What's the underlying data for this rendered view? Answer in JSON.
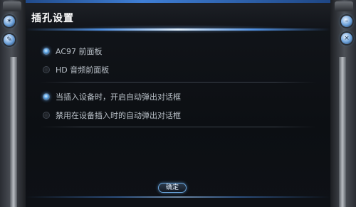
{
  "dialog": {
    "title": "插孔设置"
  },
  "options": {
    "ac97": {
      "label": "AC97 前面板",
      "checked": true
    },
    "hd": {
      "label": "HD 音频前面板",
      "checked": false
    },
    "auto_popup": {
      "label": "当插入设备时，开启自动弹出对话框",
      "checked": true
    },
    "disable_popup": {
      "label": "禁用在设备插入时的自动弹出对话框",
      "checked": false
    }
  },
  "buttons": {
    "ok_label": "确定"
  },
  "colors": {
    "accent": "#5fa7e8",
    "panel_bg": "#0c0f13",
    "text": "#b9c0c8"
  }
}
